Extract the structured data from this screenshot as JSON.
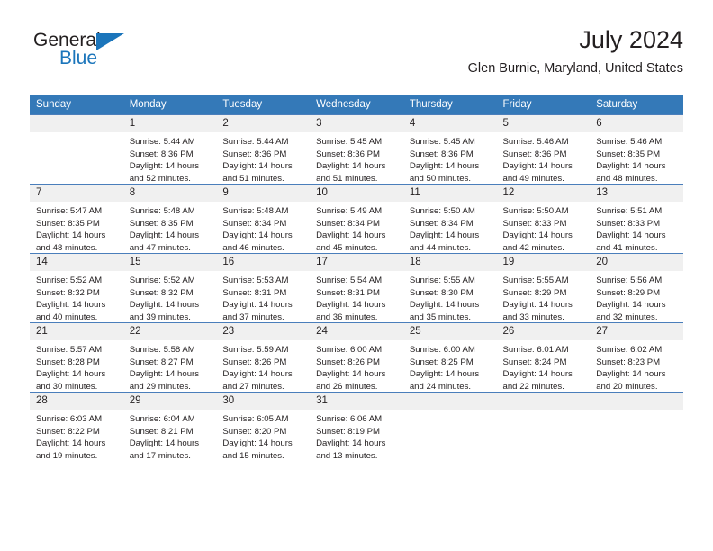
{
  "brand": {
    "word1": "General",
    "word2": "Blue",
    "accent_color": "#1b75bb",
    "triangle_icon": "triangle-icon"
  },
  "header": {
    "title": "July 2024",
    "subtitle": "Glen Burnie, Maryland, United States"
  },
  "calendar": {
    "header_bg": "#3479b8",
    "daynum_bg": "#f0f0f0",
    "weekdays": [
      "Sunday",
      "Monday",
      "Tuesday",
      "Wednesday",
      "Thursday",
      "Friday",
      "Saturday"
    ],
    "weeks": [
      [
        {
          "day": "",
          "sunrise": "",
          "sunset": "",
          "daylight_line1": "",
          "daylight_line2": "",
          "empty": true
        },
        {
          "day": "1",
          "sunrise": "Sunrise: 5:44 AM",
          "sunset": "Sunset: 8:36 PM",
          "daylight_line1": "Daylight: 14 hours",
          "daylight_line2": "and 52 minutes."
        },
        {
          "day": "2",
          "sunrise": "Sunrise: 5:44 AM",
          "sunset": "Sunset: 8:36 PM",
          "daylight_line1": "Daylight: 14 hours",
          "daylight_line2": "and 51 minutes."
        },
        {
          "day": "3",
          "sunrise": "Sunrise: 5:45 AM",
          "sunset": "Sunset: 8:36 PM",
          "daylight_line1": "Daylight: 14 hours",
          "daylight_line2": "and 51 minutes."
        },
        {
          "day": "4",
          "sunrise": "Sunrise: 5:45 AM",
          "sunset": "Sunset: 8:36 PM",
          "daylight_line1": "Daylight: 14 hours",
          "daylight_line2": "and 50 minutes."
        },
        {
          "day": "5",
          "sunrise": "Sunrise: 5:46 AM",
          "sunset": "Sunset: 8:36 PM",
          "daylight_line1": "Daylight: 14 hours",
          "daylight_line2": "and 49 minutes."
        },
        {
          "day": "6",
          "sunrise": "Sunrise: 5:46 AM",
          "sunset": "Sunset: 8:35 PM",
          "daylight_line1": "Daylight: 14 hours",
          "daylight_line2": "and 48 minutes."
        }
      ],
      [
        {
          "day": "7",
          "sunrise": "Sunrise: 5:47 AM",
          "sunset": "Sunset: 8:35 PM",
          "daylight_line1": "Daylight: 14 hours",
          "daylight_line2": "and 48 minutes."
        },
        {
          "day": "8",
          "sunrise": "Sunrise: 5:48 AM",
          "sunset": "Sunset: 8:35 PM",
          "daylight_line1": "Daylight: 14 hours",
          "daylight_line2": "and 47 minutes."
        },
        {
          "day": "9",
          "sunrise": "Sunrise: 5:48 AM",
          "sunset": "Sunset: 8:34 PM",
          "daylight_line1": "Daylight: 14 hours",
          "daylight_line2": "and 46 minutes."
        },
        {
          "day": "10",
          "sunrise": "Sunrise: 5:49 AM",
          "sunset": "Sunset: 8:34 PM",
          "daylight_line1": "Daylight: 14 hours",
          "daylight_line2": "and 45 minutes."
        },
        {
          "day": "11",
          "sunrise": "Sunrise: 5:50 AM",
          "sunset": "Sunset: 8:34 PM",
          "daylight_line1": "Daylight: 14 hours",
          "daylight_line2": "and 44 minutes."
        },
        {
          "day": "12",
          "sunrise": "Sunrise: 5:50 AM",
          "sunset": "Sunset: 8:33 PM",
          "daylight_line1": "Daylight: 14 hours",
          "daylight_line2": "and 42 minutes."
        },
        {
          "day": "13",
          "sunrise": "Sunrise: 5:51 AM",
          "sunset": "Sunset: 8:33 PM",
          "daylight_line1": "Daylight: 14 hours",
          "daylight_line2": "and 41 minutes."
        }
      ],
      [
        {
          "day": "14",
          "sunrise": "Sunrise: 5:52 AM",
          "sunset": "Sunset: 8:32 PM",
          "daylight_line1": "Daylight: 14 hours",
          "daylight_line2": "and 40 minutes."
        },
        {
          "day": "15",
          "sunrise": "Sunrise: 5:52 AM",
          "sunset": "Sunset: 8:32 PM",
          "daylight_line1": "Daylight: 14 hours",
          "daylight_line2": "and 39 minutes."
        },
        {
          "day": "16",
          "sunrise": "Sunrise: 5:53 AM",
          "sunset": "Sunset: 8:31 PM",
          "daylight_line1": "Daylight: 14 hours",
          "daylight_line2": "and 37 minutes."
        },
        {
          "day": "17",
          "sunrise": "Sunrise: 5:54 AM",
          "sunset": "Sunset: 8:31 PM",
          "daylight_line1": "Daylight: 14 hours",
          "daylight_line2": "and 36 minutes."
        },
        {
          "day": "18",
          "sunrise": "Sunrise: 5:55 AM",
          "sunset": "Sunset: 8:30 PM",
          "daylight_line1": "Daylight: 14 hours",
          "daylight_line2": "and 35 minutes."
        },
        {
          "day": "19",
          "sunrise": "Sunrise: 5:55 AM",
          "sunset": "Sunset: 8:29 PM",
          "daylight_line1": "Daylight: 14 hours",
          "daylight_line2": "and 33 minutes."
        },
        {
          "day": "20",
          "sunrise": "Sunrise: 5:56 AM",
          "sunset": "Sunset: 8:29 PM",
          "daylight_line1": "Daylight: 14 hours",
          "daylight_line2": "and 32 minutes."
        }
      ],
      [
        {
          "day": "21",
          "sunrise": "Sunrise: 5:57 AM",
          "sunset": "Sunset: 8:28 PM",
          "daylight_line1": "Daylight: 14 hours",
          "daylight_line2": "and 30 minutes."
        },
        {
          "day": "22",
          "sunrise": "Sunrise: 5:58 AM",
          "sunset": "Sunset: 8:27 PM",
          "daylight_line1": "Daylight: 14 hours",
          "daylight_line2": "and 29 minutes."
        },
        {
          "day": "23",
          "sunrise": "Sunrise: 5:59 AM",
          "sunset": "Sunset: 8:26 PM",
          "daylight_line1": "Daylight: 14 hours",
          "daylight_line2": "and 27 minutes."
        },
        {
          "day": "24",
          "sunrise": "Sunrise: 6:00 AM",
          "sunset": "Sunset: 8:26 PM",
          "daylight_line1": "Daylight: 14 hours",
          "daylight_line2": "and 26 minutes."
        },
        {
          "day": "25",
          "sunrise": "Sunrise: 6:00 AM",
          "sunset": "Sunset: 8:25 PM",
          "daylight_line1": "Daylight: 14 hours",
          "daylight_line2": "and 24 minutes."
        },
        {
          "day": "26",
          "sunrise": "Sunrise: 6:01 AM",
          "sunset": "Sunset: 8:24 PM",
          "daylight_line1": "Daylight: 14 hours",
          "daylight_line2": "and 22 minutes."
        },
        {
          "day": "27",
          "sunrise": "Sunrise: 6:02 AM",
          "sunset": "Sunset: 8:23 PM",
          "daylight_line1": "Daylight: 14 hours",
          "daylight_line2": "and 20 minutes."
        }
      ],
      [
        {
          "day": "28",
          "sunrise": "Sunrise: 6:03 AM",
          "sunset": "Sunset: 8:22 PM",
          "daylight_line1": "Daylight: 14 hours",
          "daylight_line2": "and 19 minutes."
        },
        {
          "day": "29",
          "sunrise": "Sunrise: 6:04 AM",
          "sunset": "Sunset: 8:21 PM",
          "daylight_line1": "Daylight: 14 hours",
          "daylight_line2": "and 17 minutes."
        },
        {
          "day": "30",
          "sunrise": "Sunrise: 6:05 AM",
          "sunset": "Sunset: 8:20 PM",
          "daylight_line1": "Daylight: 14 hours",
          "daylight_line2": "and 15 minutes."
        },
        {
          "day": "31",
          "sunrise": "Sunrise: 6:06 AM",
          "sunset": "Sunset: 8:19 PM",
          "daylight_line1": "Daylight: 14 hours",
          "daylight_line2": "and 13 minutes."
        },
        {
          "day": "",
          "sunrise": "",
          "sunset": "",
          "daylight_line1": "",
          "daylight_line2": "",
          "blank": true
        },
        {
          "day": "",
          "sunrise": "",
          "sunset": "",
          "daylight_line1": "",
          "daylight_line2": "",
          "blank": true
        },
        {
          "day": "",
          "sunrise": "",
          "sunset": "",
          "daylight_line1": "",
          "daylight_line2": "",
          "blank": true
        }
      ]
    ]
  }
}
